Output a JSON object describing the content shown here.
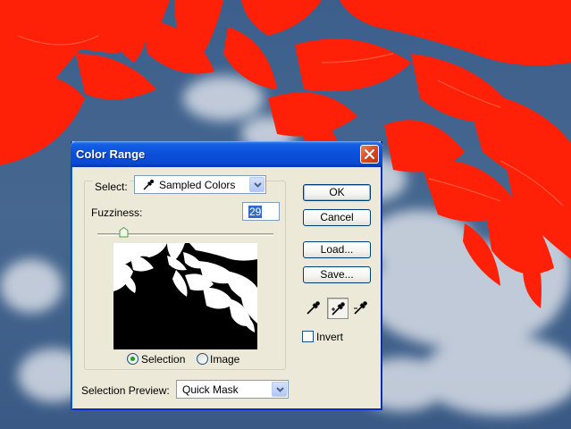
{
  "dialog": {
    "title": "Color Range",
    "select_label": "Select:",
    "select_value": "Sampled Colors",
    "fuzziness_label": "Fuzziness:",
    "fuzziness_value": "29",
    "fuzziness_level": 29,
    "radio_selection_label": "Selection",
    "radio_image_label": "Image",
    "radio_selected": "selection",
    "preview_label": "Selection Preview:",
    "preview_value": "Quick Mask",
    "invert_label": "Invert",
    "invert_checked": false
  },
  "buttons": {
    "ok": "OK",
    "cancel": "Cancel",
    "load": "Load...",
    "save": "Save..."
  },
  "icons": {
    "close": "close-icon",
    "eyedropper": "eyedropper-icon",
    "eyedropper_plus": "eyedropper-plus-icon",
    "eyedropper_minus": "eyedropper-minus-icon",
    "dropdown": "chevron-down-icon"
  },
  "colors": {
    "title_bar": "#0a4fd8",
    "leaves": "#ff2a0a",
    "sky": "#4a6a92",
    "dialog_face": "#ece9d8"
  }
}
